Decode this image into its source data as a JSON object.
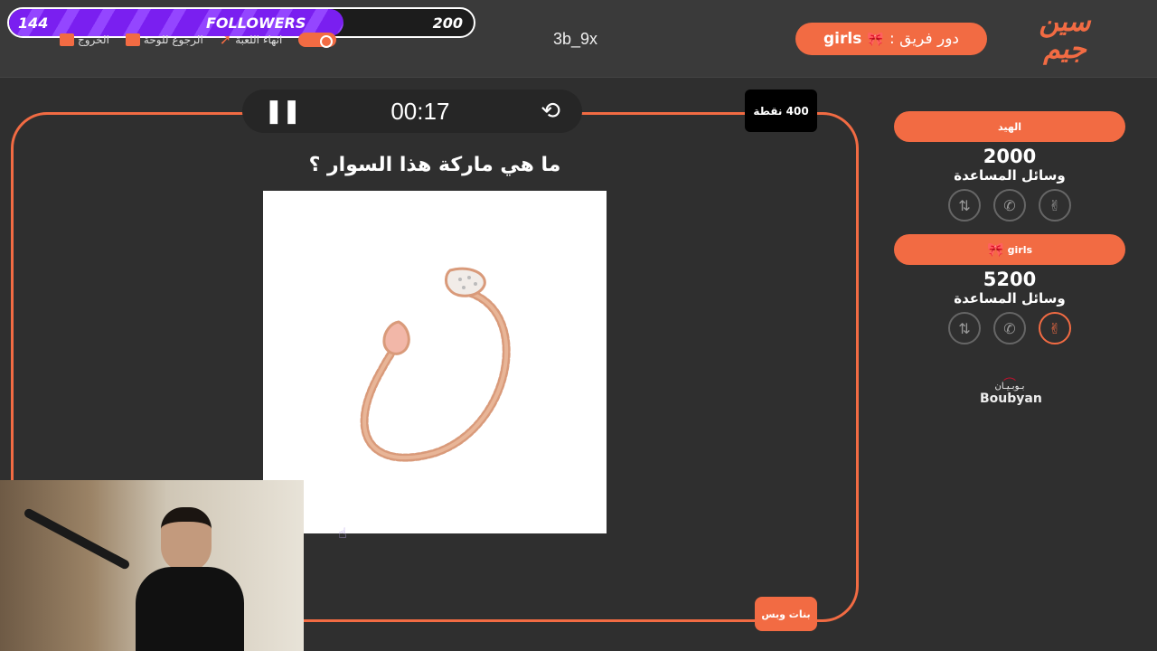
{
  "followers": {
    "current": "144",
    "label": "FOLLOWERS",
    "goal": "200",
    "progress": 0.72
  },
  "top_menu": [
    {
      "label": "الخروج",
      "icon": "exit-icon"
    },
    {
      "label": "الرجوع للوحة",
      "icon": "gift-icon"
    },
    {
      "label": "انهاء اللعبة",
      "icon": "arrow-icon"
    }
  ],
  "username": "3b_9x",
  "turn": {
    "prefix": "دور فريق :",
    "team": "girls",
    "icon": "bow-icon"
  },
  "logo": {
    "line1": "سين",
    "line2": "جيم"
  },
  "timer": {
    "time": "00:17",
    "pause_icon": "pause-icon",
    "reset_icon": "reset-icon"
  },
  "points_badge": "400 نقطة",
  "question": "ما هي ماركة هذا السوار ؟",
  "answer_tag": "بنات وبس",
  "teams": [
    {
      "name": "الهيد",
      "score": "2000",
      "aids_label": "وسائل المساعدة",
      "aids": [
        "swap-icon",
        "phone-icon",
        "peace-icon"
      ],
      "active_aid": -1
    },
    {
      "name": "girls",
      "icon": "bow-icon",
      "score": "5200",
      "aids_label": "وسائل المساعدة",
      "aids": [
        "swap-icon",
        "phone-icon",
        "peace-icon"
      ],
      "active_aid": 2
    }
  ],
  "sponsor": {
    "arabic": "بـوبـيـان",
    "english": "Boubyan"
  },
  "colors": {
    "accent": "#f26b43",
    "background": "#2f2f2f",
    "followers_fill": "#7a1ff0"
  }
}
